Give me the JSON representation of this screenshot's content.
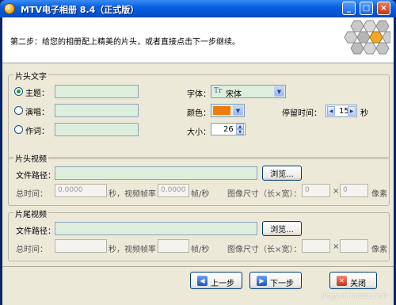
{
  "window": {
    "title": "MTV电子相册 8.4（正式版）",
    "titlebar_buttons": {
      "minimize": "_",
      "maximize": "□",
      "close": "×"
    }
  },
  "header": {
    "instruction": "第二步：给您的相册配上精美的片头，或者直接点击下一步继续。",
    "logo_icon": "hexagon-logo"
  },
  "title_text_group": {
    "title": "片头文字",
    "rows": [
      {
        "label": "主题：",
        "selected": true,
        "value": ""
      },
      {
        "label": "演唱：",
        "selected": false,
        "value": ""
      },
      {
        "label": "作词：",
        "selected": false,
        "value": ""
      }
    ],
    "font_label": "字体：",
    "font_glyph": "Tr",
    "font_value": "宋体",
    "color_label": "颜色：",
    "color_value": "#f07a0c",
    "size_label": "大小：",
    "size_value": "26",
    "duration_label": "停留时间：",
    "duration_value": "15",
    "duration_unit": "秒"
  },
  "intro_video_group": {
    "title": "片头视频",
    "path_label": "文件路径：",
    "path_value": "",
    "browse_label": "浏览...",
    "total_time_label": "总时间：",
    "total_time_value": "0.0000",
    "seconds_rate_label": "秒，视频帧率：",
    "fps_value": "0.0000",
    "fps_unit": "帧/秒",
    "size_label": "图像尺寸（长×宽）：",
    "width_value": "0",
    "times": "×",
    "height_value": "0",
    "pixel_unit": "像素"
  },
  "outro_video_group": {
    "title": "片尾视频",
    "path_label": "文件路径：",
    "path_value": "",
    "browse_label": "浏览...",
    "total_time_label": "总时间：",
    "total_time_value": "",
    "seconds_rate_label": "秒，视频帧率：",
    "fps_value": "",
    "fps_unit": "帧/秒",
    "size_label": "图像尺寸（长×宽）：",
    "width_value": "",
    "times": "×",
    "height_value": "",
    "pixel_unit": "像素"
  },
  "footer": {
    "prev_label": "上一步",
    "next_label": "下一步",
    "close_label": "关闭",
    "watermark": "jingyan.baidu.com"
  }
}
